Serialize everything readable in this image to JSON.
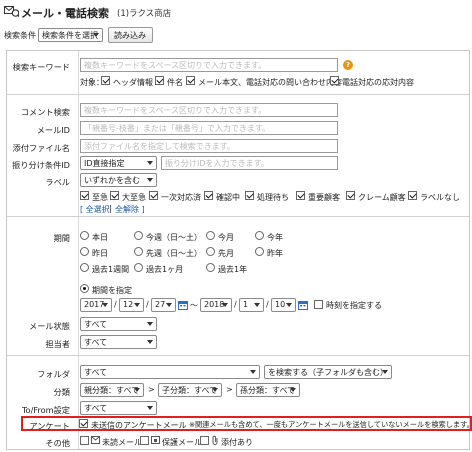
{
  "header": {
    "title": "メール・電話検索",
    "subtitle": "(1)ラクス商店"
  },
  "condition_bar": {
    "label": "検索条件",
    "select_value": "検索条件を選択",
    "load_button": "読み込み"
  },
  "search_keyword": {
    "label": "検索キーワード",
    "placeholder": "複数キーワードをスペース区切りで入力できます。",
    "target_label": "対象：",
    "targets": [
      {
        "label": "ヘッダ情報",
        "checked": true
      },
      {
        "label": "件名",
        "checked": true
      },
      {
        "label": "メール本文、電話対応の問い合わせ内容",
        "checked": true
      },
      {
        "label": "電話対応の応対内容",
        "checked": true
      }
    ]
  },
  "comment": {
    "label": "コメント検索",
    "placeholder": "複数キーワードをスペース区切りで入力できます。"
  },
  "mail_id": {
    "label": "メールID",
    "placeholder": "「親番号-枝番」または「親番号」で入力できます。"
  },
  "attachment": {
    "label": "添付ファイル名",
    "placeholder": "添付ファイル名を指定して検索できます。"
  },
  "sort_id": {
    "label": "振り分け条件ID",
    "select_value": "ID直接指定",
    "placeholder": "振り分けIDを入力できます。"
  },
  "label_filter": {
    "label": "ラベル",
    "select_value": "いずれかを含む",
    "items": [
      {
        "label": "至急",
        "checked": true
      },
      {
        "label": "大至急",
        "checked": true
      },
      {
        "label": "一次対応済",
        "checked": true
      },
      {
        "label": "確認中",
        "checked": true
      },
      {
        "label": "処理待ち",
        "checked": true
      },
      {
        "label": "重要顧客",
        "checked": true
      },
      {
        "label": "クレーム顧客",
        "checked": true
      },
      {
        "label": "ラベルなし",
        "checked": true
      }
    ],
    "select_all": "[ 全選択",
    "separator": "|",
    "deselect_all": "全解除 ]"
  },
  "period": {
    "label": "期間",
    "options_row1": [
      "本日",
      "今週（日～土）",
      "今月",
      "今年"
    ],
    "options_row2": [
      "昨日",
      "先週（日～土）",
      "先月",
      "昨年"
    ],
    "options_row3": [
      "過去1週間",
      "過去1ヶ月",
      "過去1年"
    ],
    "specify_label": "期間を指定",
    "from_year": "2017",
    "from_month": "12",
    "from_day": "27",
    "to_year": "2018",
    "to_month": "1",
    "to_day": "10",
    "slash": "/",
    "tilde": "～",
    "time_label": "時刻を指定する"
  },
  "mail_status": {
    "label": "メール状態",
    "select_value": "すべて"
  },
  "assignee": {
    "label": "担当者",
    "select_value": "すべて"
  },
  "folder": {
    "label": "フォルダ",
    "select_value": "すべて",
    "scope_value": "を検索する（子フォルダも含む）"
  },
  "classification": {
    "label": "分類",
    "parent": "親分類：すべて",
    "child": "子分類：すべて",
    "grandchild": "孫分類：すべて",
    "arrow": ">"
  },
  "to_from": {
    "label": "To/From設定",
    "select_value": "すべて"
  },
  "survey": {
    "label": "アンケート",
    "checkbox_label": "未送信のアンケートメール",
    "note": "※関連メールも含めて、一度もアンケートメールを送信していないメールを検索します。",
    "checked": true
  },
  "other": {
    "label": "その他",
    "items": [
      {
        "label": "未読メール",
        "checked": false
      },
      {
        "label": "保護メール",
        "checked": false
      },
      {
        "label": "添付あり",
        "checked": false
      }
    ]
  },
  "colors": {
    "highlight_border": "#e02020",
    "link": "#1a5aa8",
    "help": "#e8960c"
  }
}
